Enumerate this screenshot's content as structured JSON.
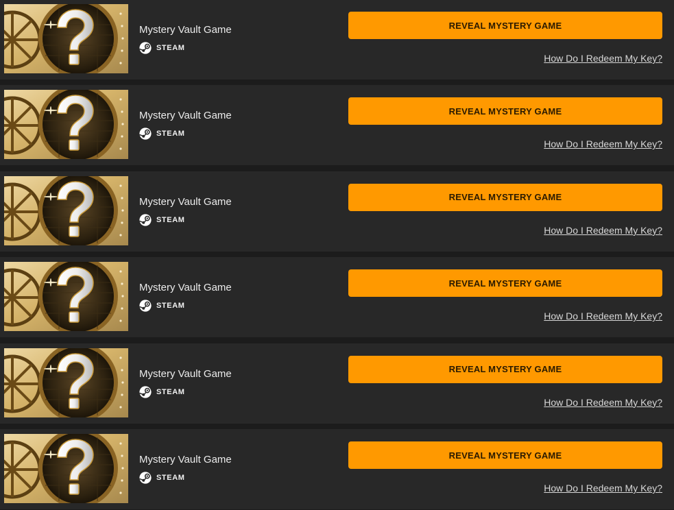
{
  "items": [
    {
      "title": "Mystery Vault Game",
      "platform": "STEAM",
      "button_label": "REVEAL MYSTERY GAME",
      "link_label": "How Do I Redeem My Key?"
    },
    {
      "title": "Mystery Vault Game",
      "platform": "STEAM",
      "button_label": "REVEAL MYSTERY GAME",
      "link_label": "How Do I Redeem My Key?"
    },
    {
      "title": "Mystery Vault Game",
      "platform": "STEAM",
      "button_label": "REVEAL MYSTERY GAME",
      "link_label": "How Do I Redeem My Key?"
    },
    {
      "title": "Mystery Vault Game",
      "platform": "STEAM",
      "button_label": "REVEAL MYSTERY GAME",
      "link_label": "How Do I Redeem My Key?"
    },
    {
      "title": "Mystery Vault Game",
      "platform": "STEAM",
      "button_label": "REVEAL MYSTERY GAME",
      "link_label": "How Do I Redeem My Key?"
    },
    {
      "title": "Mystery Vault Game",
      "platform": "STEAM",
      "button_label": "REVEAL MYSTERY GAME",
      "link_label": "How Do I Redeem My Key?"
    }
  ],
  "icons": {
    "thumbnail": "vault-question-mark-image",
    "platform": "steam-icon"
  },
  "colors": {
    "background": "#282828",
    "separator": "#1c1c1c",
    "button": "#ff9900",
    "button_text": "#2a1a00",
    "text": "#ececec",
    "link": "#d8d8d8"
  }
}
